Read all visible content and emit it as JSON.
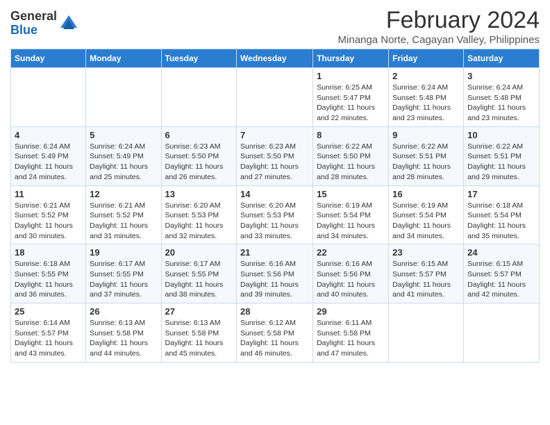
{
  "logo": {
    "general": "General",
    "blue": "Blue"
  },
  "title": "February 2024",
  "subtitle": "Minanga Norte, Cagayan Valley, Philippines",
  "headers": [
    "Sunday",
    "Monday",
    "Tuesday",
    "Wednesday",
    "Thursday",
    "Friday",
    "Saturday"
  ],
  "weeks": [
    [
      {
        "day": "",
        "info": ""
      },
      {
        "day": "",
        "info": ""
      },
      {
        "day": "",
        "info": ""
      },
      {
        "day": "",
        "info": ""
      },
      {
        "day": "1",
        "info": "Sunrise: 6:25 AM\nSunset: 5:47 PM\nDaylight: 11 hours and 22 minutes."
      },
      {
        "day": "2",
        "info": "Sunrise: 6:24 AM\nSunset: 5:48 PM\nDaylight: 11 hours and 23 minutes."
      },
      {
        "day": "3",
        "info": "Sunrise: 6:24 AM\nSunset: 5:48 PM\nDaylight: 11 hours and 23 minutes."
      }
    ],
    [
      {
        "day": "4",
        "info": "Sunrise: 6:24 AM\nSunset: 5:49 PM\nDaylight: 11 hours and 24 minutes."
      },
      {
        "day": "5",
        "info": "Sunrise: 6:24 AM\nSunset: 5:49 PM\nDaylight: 11 hours and 25 minutes."
      },
      {
        "day": "6",
        "info": "Sunrise: 6:23 AM\nSunset: 5:50 PM\nDaylight: 11 hours and 26 minutes."
      },
      {
        "day": "7",
        "info": "Sunrise: 6:23 AM\nSunset: 5:50 PM\nDaylight: 11 hours and 27 minutes."
      },
      {
        "day": "8",
        "info": "Sunrise: 6:22 AM\nSunset: 5:50 PM\nDaylight: 11 hours and 28 minutes."
      },
      {
        "day": "9",
        "info": "Sunrise: 6:22 AM\nSunset: 5:51 PM\nDaylight: 11 hours and 28 minutes."
      },
      {
        "day": "10",
        "info": "Sunrise: 6:22 AM\nSunset: 5:51 PM\nDaylight: 11 hours and 29 minutes."
      }
    ],
    [
      {
        "day": "11",
        "info": "Sunrise: 6:21 AM\nSunset: 5:52 PM\nDaylight: 11 hours and 30 minutes."
      },
      {
        "day": "12",
        "info": "Sunrise: 6:21 AM\nSunset: 5:52 PM\nDaylight: 11 hours and 31 minutes."
      },
      {
        "day": "13",
        "info": "Sunrise: 6:20 AM\nSunset: 5:53 PM\nDaylight: 11 hours and 32 minutes."
      },
      {
        "day": "14",
        "info": "Sunrise: 6:20 AM\nSunset: 5:53 PM\nDaylight: 11 hours and 33 minutes."
      },
      {
        "day": "15",
        "info": "Sunrise: 6:19 AM\nSunset: 5:54 PM\nDaylight: 11 hours and 34 minutes."
      },
      {
        "day": "16",
        "info": "Sunrise: 6:19 AM\nSunset: 5:54 PM\nDaylight: 11 hours and 34 minutes."
      },
      {
        "day": "17",
        "info": "Sunrise: 6:18 AM\nSunset: 5:54 PM\nDaylight: 11 hours and 35 minutes."
      }
    ],
    [
      {
        "day": "18",
        "info": "Sunrise: 6:18 AM\nSunset: 5:55 PM\nDaylight: 11 hours and 36 minutes."
      },
      {
        "day": "19",
        "info": "Sunrise: 6:17 AM\nSunset: 5:55 PM\nDaylight: 11 hours and 37 minutes."
      },
      {
        "day": "20",
        "info": "Sunrise: 6:17 AM\nSunset: 5:55 PM\nDaylight: 11 hours and 38 minutes."
      },
      {
        "day": "21",
        "info": "Sunrise: 6:16 AM\nSunset: 5:56 PM\nDaylight: 11 hours and 39 minutes."
      },
      {
        "day": "22",
        "info": "Sunrise: 6:16 AM\nSunset: 5:56 PM\nDaylight: 11 hours and 40 minutes."
      },
      {
        "day": "23",
        "info": "Sunrise: 6:15 AM\nSunset: 5:57 PM\nDaylight: 11 hours and 41 minutes."
      },
      {
        "day": "24",
        "info": "Sunrise: 6:15 AM\nSunset: 5:57 PM\nDaylight: 11 hours and 42 minutes."
      }
    ],
    [
      {
        "day": "25",
        "info": "Sunrise: 6:14 AM\nSunset: 5:57 PM\nDaylight: 11 hours and 43 minutes."
      },
      {
        "day": "26",
        "info": "Sunrise: 6:13 AM\nSunset: 5:58 PM\nDaylight: 11 hours and 44 minutes."
      },
      {
        "day": "27",
        "info": "Sunrise: 6:13 AM\nSunset: 5:58 PM\nDaylight: 11 hours and 45 minutes."
      },
      {
        "day": "28",
        "info": "Sunrise: 6:12 AM\nSunset: 5:58 PM\nDaylight: 11 hours and 46 minutes."
      },
      {
        "day": "29",
        "info": "Sunrise: 6:11 AM\nSunset: 5:58 PM\nDaylight: 11 hours and 47 minutes."
      },
      {
        "day": "",
        "info": ""
      },
      {
        "day": "",
        "info": ""
      }
    ]
  ]
}
